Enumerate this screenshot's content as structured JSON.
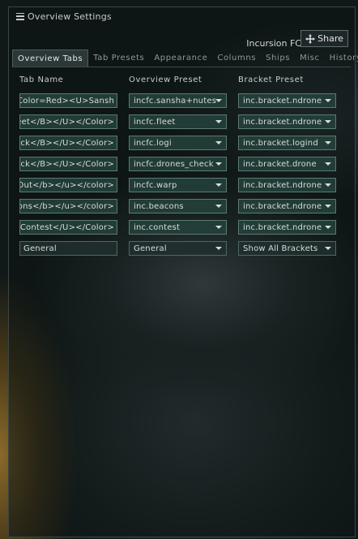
{
  "window": {
    "title": "Overview Settings"
  },
  "header": {
    "fleet_name": "Incursion FC",
    "share_label": "Share"
  },
  "tabs": [
    {
      "label": "Overview Tabs",
      "active": true
    },
    {
      "label": "Tab Presets",
      "active": false
    },
    {
      "label": "Appearance",
      "active": false
    },
    {
      "label": "Columns",
      "active": false
    },
    {
      "label": "Ships",
      "active": false
    },
    {
      "label": "Misc",
      "active": false
    },
    {
      "label": "History",
      "active": false
    }
  ],
  "columns": {
    "tab_name": "Tab Name",
    "overview_preset": "Overview Preset",
    "bracket_preset": "Bracket Preset"
  },
  "rows": [
    {
      "tab_name": "<Color=Red><U>Sansh",
      "overview_preset": "incfc.sansha+nutes",
      "bracket_preset": "inc.bracket.ndrone"
    },
    {
      "tab_name": ">Fleet</B></U></Color>",
      "overview_preset": "incfc.fleet",
      "bracket_preset": "inc.bracket.ndrone"
    },
    {
      "tab_name": "Check</B></U></Color>",
      "overview_preset": "incfc.logi",
      "bracket_preset": "inc.bracket.logind"
    },
    {
      "tab_name": "Check</B></U></Color>",
      "overview_preset": "incfc.drones_check",
      "bracket_preset": "inc.bracket.drone"
    },
    {
      "tab_name": "n-Out</b></u></color>",
      "overview_preset": "incfc.warp",
      "bracket_preset": "inc.bracket.ndrone"
    },
    {
      "tab_name": "eacons</b></u></color>",
      "overview_preset": "inc.beacons",
      "bracket_preset": "inc.bracket.ndrone"
    },
    {
      "tab_name": "U>Contest</U></Color>",
      "overview_preset": "inc.contest",
      "bracket_preset": "inc.bracket.ndrone"
    },
    {
      "tab_name": "General",
      "overview_preset": "General",
      "bracket_preset": "Show All Brackets"
    }
  ]
}
